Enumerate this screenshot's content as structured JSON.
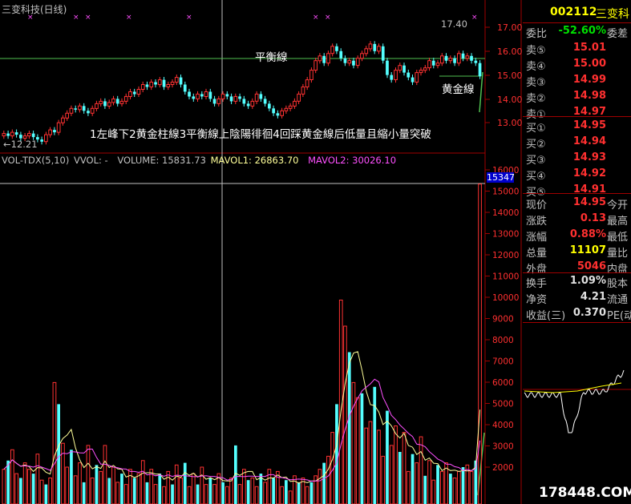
{
  "window": {
    "title": "三变科技(日线)"
  },
  "stock": {
    "code": "002112",
    "name": "三变科"
  },
  "annotations": {
    "balance_line": "平衡線",
    "golden_line": "黄金線",
    "high_label": "17.40",
    "low_label": "←12.21",
    "summary": "1左峰下2黄金柱線3平衡線上陰陽徘徊4回踩黄金線后低量且縮小量突破"
  },
  "indicator": {
    "name": "VOL-TDX(5,10)",
    "vvol": "VVOL: -",
    "volume": "VOLUME: 15831.73",
    "mavol1": "MAVOL1: 26863.70",
    "mavol2": "MAVOL2: 30026.10"
  },
  "price_axis": [
    "17.00",
    "16.00",
    "15.00",
    "14.00",
    "13.00"
  ],
  "volume_axis": [
    "16000",
    "15000",
    "14000",
    "13000",
    "12000",
    "11000",
    "10000",
    "9000",
    "8000",
    "7000",
    "6000",
    "5000",
    "4000",
    "3000",
    "2000"
  ],
  "current_volume_box": "15347",
  "order_book": {
    "ratio_label": "委比",
    "ratio_value": "-52.60%",
    "ratio_extra": "委差",
    "sells": [
      {
        "label": "卖⑤",
        "price": "15.01"
      },
      {
        "label": "卖④",
        "price": "15.00"
      },
      {
        "label": "卖③",
        "price": "14.99"
      },
      {
        "label": "卖②",
        "price": "14.98"
      },
      {
        "label": "卖①",
        "price": "14.97"
      }
    ],
    "buys": [
      {
        "label": "买①",
        "price": "14.95"
      },
      {
        "label": "买②",
        "price": "14.94"
      },
      {
        "label": "买③",
        "price": "14.93"
      },
      {
        "label": "买④",
        "price": "14.92"
      },
      {
        "label": "买⑤",
        "price": "14.91"
      }
    ]
  },
  "quote": [
    {
      "label": "现价",
      "value": "14.95",
      "extra": "今开",
      "color": "#ff3030"
    },
    {
      "label": "涨跌",
      "value": "0.13",
      "extra": "最高",
      "color": "#ff3030"
    },
    {
      "label": "涨幅",
      "value": "0.88%",
      "extra": "最低",
      "color": "#ff3030"
    },
    {
      "label": "总量",
      "value": "11107",
      "extra": "量比",
      "color": "#ffff00"
    },
    {
      "label": "外盘",
      "value": "5046",
      "extra": "内盘",
      "color": "#ff3030"
    }
  ],
  "stats": [
    {
      "label": "换手",
      "value": "1.09%",
      "extra": "股本"
    },
    {
      "label": "净资",
      "value": "4.21",
      "extra": "流通"
    },
    {
      "label": "收益(三)",
      "value": "0.370",
      "extra": "PE(动"
    }
  ],
  "watermark": "178448.COM",
  "colors": {
    "up": "#ff3232",
    "down": "#54ffff",
    "ma_white": "#ffff99",
    "ma_magenta": "#ff50ff",
    "balance": "#50c050"
  }
}
